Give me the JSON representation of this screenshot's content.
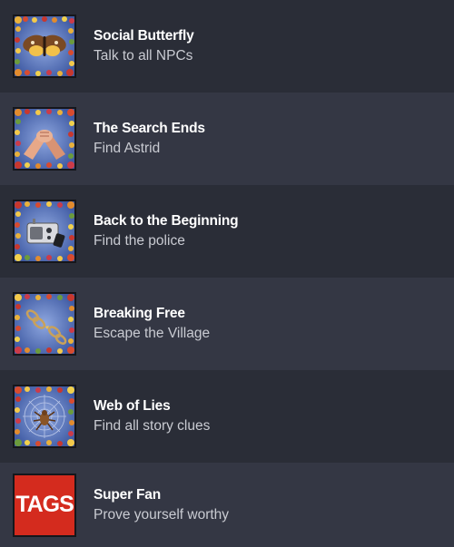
{
  "achievements": [
    {
      "title": "Social Butterfly",
      "description": "Talk to all NPCs",
      "icon": "butterfly-icon"
    },
    {
      "title": "The Search Ends",
      "description": "Find Astrid",
      "icon": "handshake-icon"
    },
    {
      "title": "Back to the Beginning",
      "description": "Find the police",
      "icon": "radio-icon"
    },
    {
      "title": "Breaking Free",
      "description": "Escape the Village",
      "icon": "broken-chain-icon"
    },
    {
      "title": "Web of Lies",
      "description": "Find all story clues",
      "icon": "spider-web-icon"
    },
    {
      "title": "Super Fan",
      "description": "Prove yourself worthy",
      "icon": "tags-logo-icon",
      "icon_text": "TAGS"
    }
  ],
  "colors": {
    "background": "#2b2e38",
    "row_alt": "#343744",
    "icon_bg": "#5f7fc3",
    "tags_red": "#d42b1e"
  }
}
